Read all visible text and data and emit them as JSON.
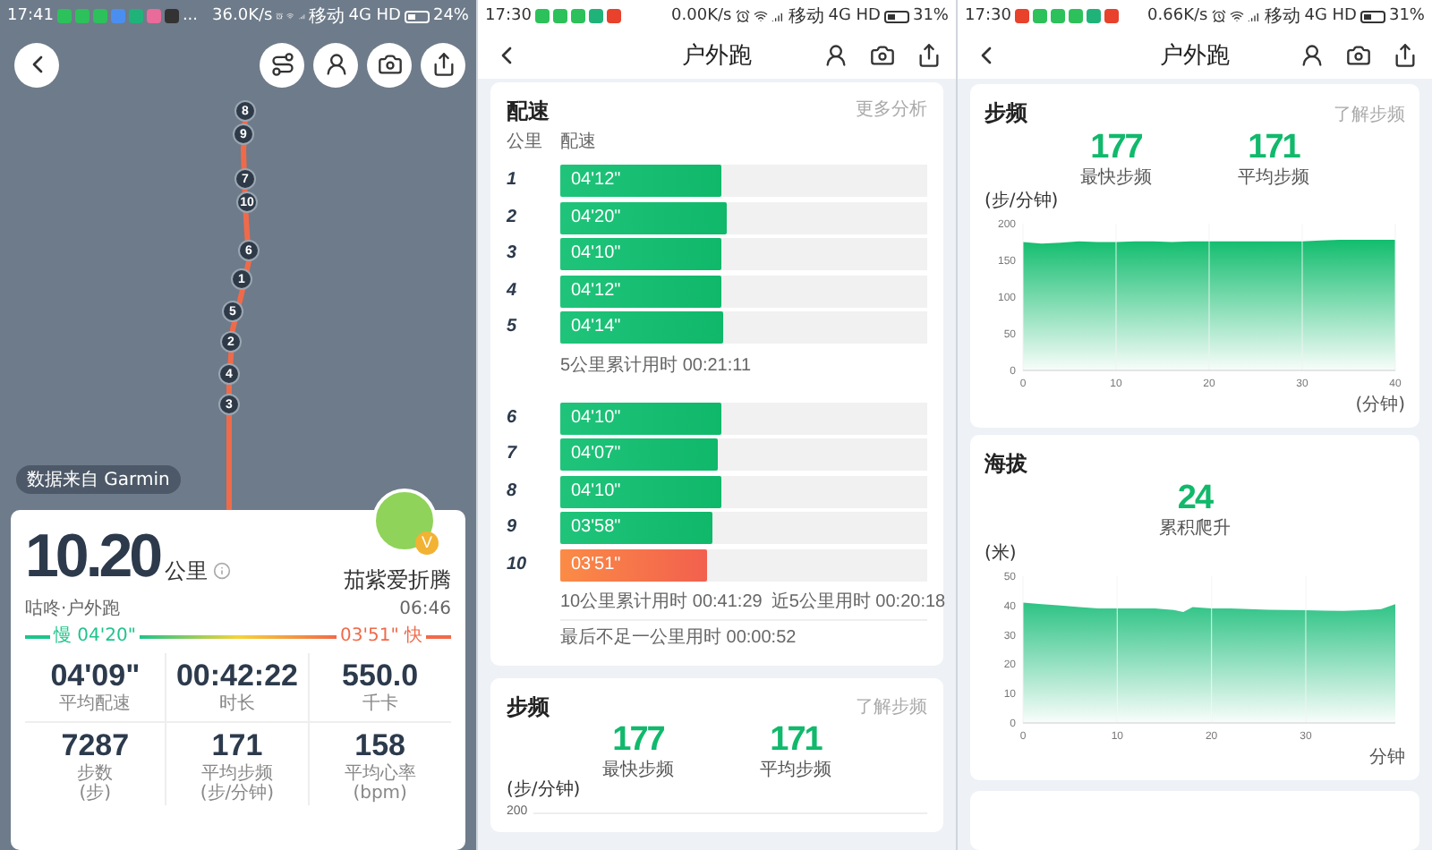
{
  "screens": [
    {
      "kind": "map",
      "status_bar": {
        "time": "17:41",
        "notifications": [
          {
            "kind": "wechat"
          },
          {
            "kind": "wechat"
          },
          {
            "kind": "wechat"
          },
          {
            "kind": "gallery"
          },
          {
            "kind": "green"
          },
          {
            "kind": "pink"
          },
          {
            "kind": "dark"
          }
        ],
        "more": "...",
        "speed": "36.0K/s",
        "carrier": "移动",
        "network": "4G HD",
        "battery": "24%"
      },
      "map": {
        "markers": [
          "8",
          "9",
          "7",
          "10",
          "6",
          "1",
          "5",
          "2",
          "4",
          "3"
        ]
      },
      "source": "数据来自 Garmin",
      "summary": {
        "distance": "10.20",
        "unit": "公里",
        "user": "茄紫爱折腾",
        "badge": "V",
        "source_app": "咕咚·户外跑",
        "time": "06:46",
        "slow": "慢 04'20\"",
        "fast": "03'51\" 快",
        "stats": [
          {
            "value": "04'09\"",
            "label": "平均配速"
          },
          {
            "value": "00:42:22",
            "label": "时长"
          },
          {
            "value": "550.0",
            "label": "千卡"
          },
          {
            "value": "7287",
            "label": "步数",
            "unit": "(步)"
          },
          {
            "value": "171",
            "label": "平均步频",
            "unit": "(步/分钟)"
          },
          {
            "value": "158",
            "label": "平均心率",
            "unit": "(bpm)"
          }
        ]
      }
    },
    {
      "kind": "pace",
      "status_bar": {
        "time": "17:30",
        "notifications": [
          {
            "kind": "wechat"
          },
          {
            "kind": "wechat"
          },
          {
            "kind": "wechat"
          },
          {
            "kind": "green"
          },
          {
            "kind": "red"
          }
        ],
        "speed": "0.00K/s",
        "carrier": "移动",
        "network": "4G HD",
        "battery": "31%"
      },
      "title": "户外跑",
      "pace": {
        "title": "配速",
        "link": "更多分析",
        "col_km": "公里",
        "col_pace": "配速",
        "groups": [
          {
            "rows": [
              {
                "km": "1",
                "pace": "04'12\"",
                "level": 0.44,
                "fastest": false
              },
              {
                "km": "2",
                "pace": "04'20\"",
                "level": 0.455,
                "fastest": false
              },
              {
                "km": "3",
                "pace": "04'10\"",
                "level": 0.44,
                "fastest": false
              },
              {
                "km": "4",
                "pace": "04'12\"",
                "level": 0.44,
                "fastest": false
              },
              {
                "km": "5",
                "pace": "04'14\"",
                "level": 0.445,
                "fastest": false
              }
            ],
            "notes": [
              [
                "5公里累计用时 00:21:11"
              ]
            ]
          },
          {
            "rows": [
              {
                "km": "6",
                "pace": "04'10\"",
                "level": 0.44,
                "fastest": false
              },
              {
                "km": "7",
                "pace": "04'07\"",
                "level": 0.43,
                "fastest": false
              },
              {
                "km": "8",
                "pace": "04'10\"",
                "level": 0.44,
                "fastest": false
              },
              {
                "km": "9",
                "pace": "03'58\"",
                "level": 0.415,
                "fastest": false
              },
              {
                "km": "10",
                "pace": "03'51\"",
                "level": 0.4,
                "fastest": true
              }
            ],
            "notes": [
              [
                "10公里累计用时 00:41:29",
                "近5公里用时 00:20:18"
              ],
              [
                "最后不足一公里用时 00:00:52"
              ]
            ]
          }
        ]
      },
      "cadence": {
        "title": "步频",
        "link": "了解步频",
        "stats": [
          {
            "value": "177",
            "label": "最快步频"
          },
          {
            "value": "171",
            "label": "平均步频"
          }
        ],
        "unit": "(步/分钟)",
        "top_tick": "200"
      }
    },
    {
      "kind": "charts",
      "status_bar": {
        "time": "17:30",
        "notifications": [
          {
            "kind": "red"
          },
          {
            "kind": "wechat"
          },
          {
            "kind": "wechat"
          },
          {
            "kind": "wechat"
          },
          {
            "kind": "green"
          },
          {
            "kind": "red"
          }
        ],
        "speed": "0.66K/s",
        "carrier": "移动",
        "network": "4G HD",
        "battery": "31%"
      },
      "title": "户外跑",
      "cards": [
        {
          "title": "步频",
          "link": "了解步频",
          "stats": [
            {
              "value": "177",
              "label": "最快步频"
            },
            {
              "value": "171",
              "label": "平均步频"
            }
          ],
          "chart_data": {
            "type": "area",
            "xlabel": "(分钟)",
            "ylabel": "(步/分钟)",
            "x": [
              0,
              2,
              4,
              6,
              8,
              10,
              12,
              14,
              16,
              18,
              20,
              22,
              24,
              26,
              28,
              30,
              32,
              34,
              36,
              38,
              40
            ],
            "series": [
              {
                "color": "#12bd6e",
                "values": [
                  175,
                  173,
                  174,
                  176,
                  175,
                  175,
                  176,
                  176,
                  175,
                  176,
                  176,
                  176,
                  176,
                  176,
                  176,
                  176,
                  177,
                  178,
                  178,
                  178,
                  178
                ]
              }
            ],
            "xlim": [
              0,
              40
            ],
            "ylim": [
              0,
              200
            ],
            "xticks": [
              0,
              10,
              20,
              30,
              40
            ],
            "yticks": [
              0,
              50,
              100,
              150,
              200
            ],
            "grid": true
          }
        },
        {
          "title": "海拔",
          "stats": [
            {
              "value": "24",
              "label": "累积爬升"
            }
          ],
          "chart_data": {
            "type": "area",
            "xlabel": "分钟",
            "ylabel": "(米)",
            "x": [
              0,
              2,
              4,
              6,
              8,
              10,
              12,
              14,
              16,
              17,
              18,
              20,
              22,
              24,
              26,
              28,
              30,
              32,
              34,
              36,
              38,
              39.5
            ],
            "series": [
              {
                "color": "#2ec385",
                "values": [
                  41,
                  40.5,
                  40,
                  39.5,
                  39,
                  39,
                  39,
                  39,
                  38.5,
                  37.8,
                  39.5,
                  39,
                  39,
                  38.8,
                  38.6,
                  38.5,
                  38.4,
                  38.3,
                  38.2,
                  38.4,
                  38.8,
                  40.5
                ]
              }
            ],
            "xlim": [
              0,
              39.5
            ],
            "ylim": [
              0,
              50
            ],
            "xticks": [
              0,
              10,
              20,
              30
            ],
            "yticks": [
              0,
              10,
              20,
              30,
              40,
              50
            ],
            "grid": true
          }
        }
      ]
    }
  ]
}
